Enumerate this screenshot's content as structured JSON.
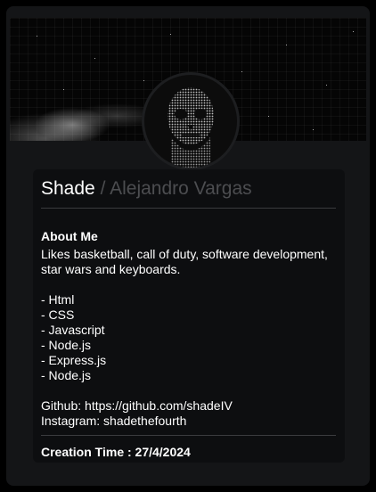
{
  "profile": {
    "name": "Shade",
    "separator": "/",
    "real_name": "Alejandro Vargas"
  },
  "about": {
    "heading": "About Me",
    "intro_line1": "Likes basketball, call of duty, software development,",
    "intro_line2": "star wars and keyboards.",
    "skills": [
      "- Html",
      "- CSS",
      "- Javascript",
      "- Node.js",
      "- Express.js",
      "- Node.js"
    ],
    "github": "Github: https://github.com/shadeIV",
    "instagram": "Instagram: shadethefourth"
  },
  "footer": {
    "creation_time": "Creation Time : 27/4/2024"
  },
  "colors": {
    "page_bg": "#000000",
    "card_bg": "#141517",
    "content_bg": "#0d0e10",
    "muted_text": "#4c4d50"
  },
  "icons": {
    "avatar": "skull-face-avatar",
    "banner": "night-sky-banner"
  }
}
